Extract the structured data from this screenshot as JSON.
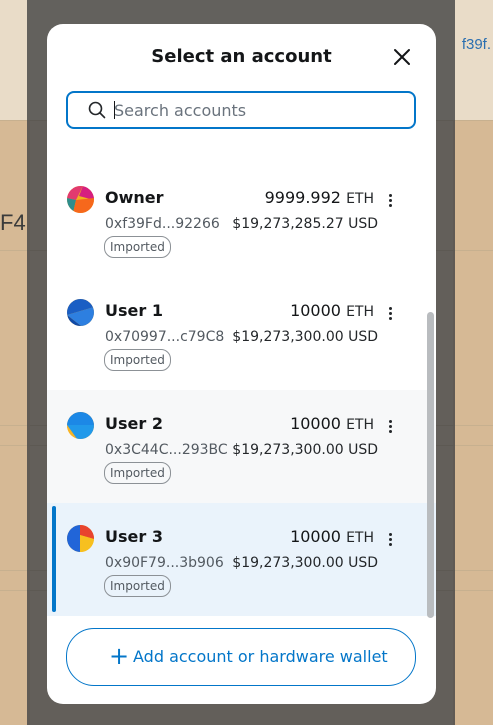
{
  "background": {
    "left_text": "F4",
    "right_link": "f39f."
  },
  "modal": {
    "title": "Select an account",
    "search": {
      "placeholder": "Search accounts",
      "value": ""
    },
    "add_button_label": "Add account or hardware wallet"
  },
  "accounts": [
    {
      "name": "Owner",
      "address": "0xf39Fd...92266",
      "balance": "9999.992",
      "unit": "ETH",
      "usd": "$19,273,285.27 USD",
      "badge": "Imported",
      "selected": false
    },
    {
      "name": "User 1",
      "address": "0x70997...c79C8",
      "balance": "10000",
      "unit": "ETH",
      "usd": "$19,273,300.00 USD",
      "badge": "Imported",
      "selected": false
    },
    {
      "name": "User 2",
      "address": "0x3C44C...293BC",
      "balance": "10000",
      "unit": "ETH",
      "usd": "$19,273,300.00 USD",
      "badge": "Imported",
      "selected": false
    },
    {
      "name": "User 3",
      "address": "0x90F79...3b906",
      "balance": "10000",
      "unit": "ETH",
      "usd": "$19,273,300.00 USD",
      "badge": "Imported",
      "selected": true
    }
  ],
  "colors": {
    "accent": "#0376c9",
    "selected_bg": "#eaf3fb"
  }
}
